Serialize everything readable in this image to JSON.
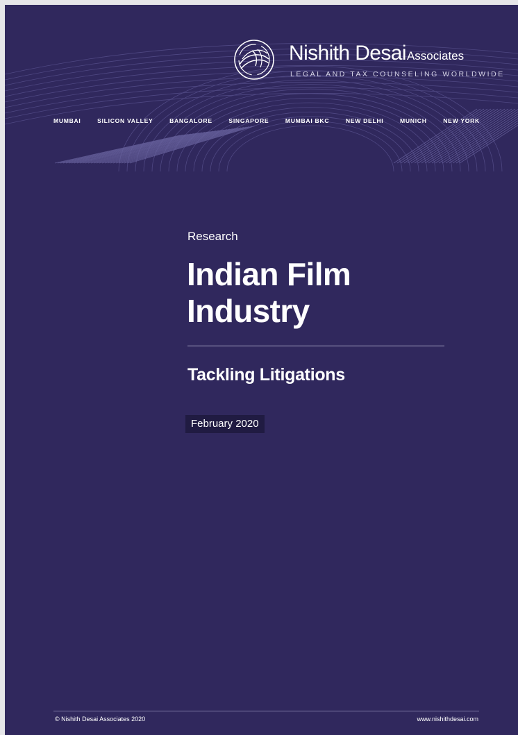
{
  "brand": {
    "name": "Nishith Desai",
    "suffix": "Associates",
    "tagline": "LEGAL AND TAX COUNSELING WORLDWIDE",
    "logo_icon": "nda-circle-logo-icon"
  },
  "cities": [
    "MUMBAI",
    "SILICON VALLEY",
    "BANGALORE",
    "SINGAPORE",
    "MUMBAI BKC",
    "NEW DELHI",
    "MUNICH",
    "NEW YORK"
  ],
  "cover": {
    "label": "Research",
    "title_line1": "Indian Film",
    "title_line2": "Industry",
    "subtitle": "Tackling Litigations",
    "date": "February 2020"
  },
  "footer": {
    "copyright": "© Nishith Desai Associates 2020",
    "website": "www.nishithdesai.com"
  },
  "colors": {
    "background": "#30285d",
    "date_badge": "#201b42",
    "text": "#ffffff"
  }
}
